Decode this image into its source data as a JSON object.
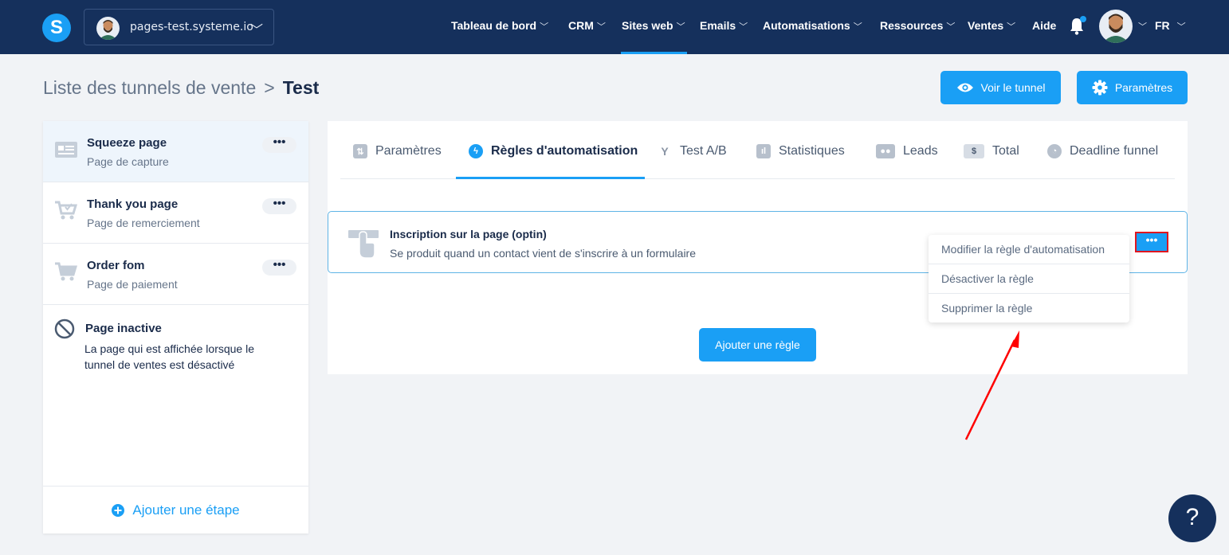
{
  "nav": {
    "site_name": "pages-test.systeme.io",
    "items": [
      {
        "label": "Tableau de bord"
      },
      {
        "label": "CRM"
      },
      {
        "label": "Sites web"
      },
      {
        "label": "Emails"
      },
      {
        "label": "Automatisations"
      },
      {
        "label": "Ressources"
      },
      {
        "label": "Ventes"
      },
      {
        "label": "Aide"
      }
    ],
    "active_item": "Sites web",
    "language": "FR",
    "logo_letter": "S"
  },
  "breadcrumb": {
    "parent": "Liste des tunnels de vente",
    "separator": ">",
    "current": "Test"
  },
  "header_buttons": {
    "view_funnel": "Voir le tunnel",
    "settings": "Paramètres"
  },
  "steps": [
    {
      "title": "Squeeze page",
      "subtitle": "Page de capture",
      "more": "•••",
      "icon": "squeeze-page-icon",
      "active": true
    },
    {
      "title": "Thank you page",
      "subtitle": "Page de remerciement",
      "more": "•••",
      "icon": "cart-check-icon"
    },
    {
      "title": "Order fom",
      "subtitle": "Page de paiement",
      "more": "•••",
      "icon": "cart-icon"
    }
  ],
  "inactive_page": {
    "title": "Page inactive",
    "description": "La page qui est affichée lorsque le tunnel de ventes est désactivé"
  },
  "add_step": "Ajouter une étape",
  "tabs": [
    {
      "label": "Paramètres",
      "icon": "sliders-icon"
    },
    {
      "label": "Règles d'automatisation",
      "icon": "bolt-icon",
      "active": true
    },
    {
      "label": "Test A/B",
      "icon": "split-icon"
    },
    {
      "label": "Statistiques",
      "icon": "bar-chart-icon"
    },
    {
      "label": "Leads",
      "icon": "users-icon"
    },
    {
      "label": "Total",
      "icon": "dollar-icon"
    },
    {
      "label": "Deadline funnel",
      "icon": "clock-icon"
    }
  ],
  "rule": {
    "title": "Inscription sur la page (optin)",
    "description": "Se produit quand un contact vient de s'inscrire à un formulaire",
    "more": "•••"
  },
  "rule_menu": [
    {
      "label": "Modifier la règle d'automatisation"
    },
    {
      "label": "Désactiver la règle"
    },
    {
      "label": "Supprimer la règle"
    }
  ],
  "add_rule": "Ajouter une règle",
  "help": "?",
  "colors": {
    "navy": "#15305c",
    "accent": "#1a9ff5",
    "highlight_border": "#e0161f",
    "arrow": "#ff0000"
  }
}
